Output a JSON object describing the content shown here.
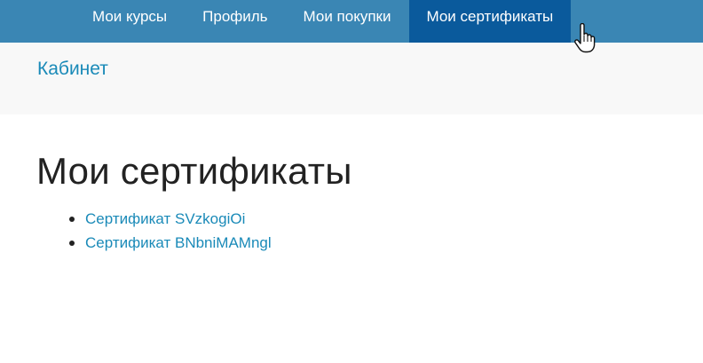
{
  "nav": {
    "items": [
      {
        "label": "Мои курсы",
        "active": false
      },
      {
        "label": "Профиль",
        "active": false
      },
      {
        "label": "Мои покупки",
        "active": false
      },
      {
        "label": "Мои сертификаты",
        "active": true
      }
    ]
  },
  "breadcrumb": {
    "label": "Кабинет"
  },
  "main": {
    "title": "Мои сертификаты",
    "certificates": [
      {
        "label": "Сертификат SVzkogiOi"
      },
      {
        "label": "Сертификат BNbniMAMngl"
      }
    ]
  },
  "colors": {
    "nav_bg": "#3a86b4",
    "nav_active_bg": "#0a5a9c",
    "link": "#1a8ab8",
    "subbar_bg": "#f8f8f8"
  },
  "icons": {
    "cursor": "hand-pointer-icon"
  }
}
